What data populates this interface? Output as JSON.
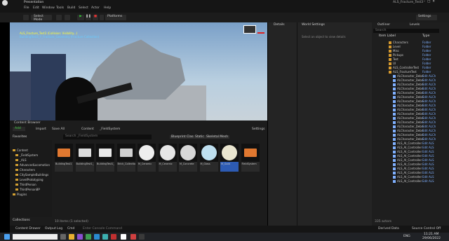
{
  "window": {
    "project_tab": "Presentation",
    "app_title": "ALS_Fracture_Test3"
  },
  "menu": [
    "File",
    "Edit",
    "Window",
    "Tools",
    "Build",
    "Select",
    "Actor",
    "Help"
  ],
  "toolbar": {
    "select_mode": "Select Mode",
    "platforms": "Platforms",
    "settings": "Settings"
  },
  "viewport": {
    "overlay1": "ALS_Fracture_Test3 (Collision: Visibility...)",
    "overlay2": "BuildingTest3_Y_Fracture_Geometry (Fracture Collection)"
  },
  "details": {
    "tab1": "Details",
    "tab2": "World Settings",
    "empty_msg": "Select an object to view details"
  },
  "outliner": {
    "tab1": "Outliner",
    "tab2": "Levels",
    "search": "Search",
    "col_label": "Item Label",
    "col_type": "Type",
    "actor_count": "335 actors",
    "rows": [
      {
        "label": "Characters",
        "type": "Folder"
      },
      {
        "label": "Level",
        "type": "Folder"
      },
      {
        "label": "Misc",
        "type": "Folder"
      },
      {
        "label": "Pickups",
        "type": "Folder"
      },
      {
        "label": "Test",
        "type": "Folder"
      },
      {
        "label": "UI",
        "type": "Folder"
      },
      {
        "label": "ALS_ControllerTest",
        "type": "Folder"
      },
      {
        "label": "ALS_FractureTest",
        "type": "Folder"
      },
      {
        "label": "ALCharacter_Debri",
        "type": "Edit ALCh"
      },
      {
        "label": "ALCharacter_Debri",
        "type": "Edit ALCh"
      },
      {
        "label": "ALCharacter_Debri",
        "type": "Edit ALCh"
      },
      {
        "label": "ALCharacter_Debri",
        "type": "Edit ALCh"
      },
      {
        "label": "ALCharacter_Debri",
        "type": "Edit ALCh"
      },
      {
        "label": "ALCharacter_Debri",
        "type": "Edit ALCh"
      },
      {
        "label": "ALCharacter_Debri",
        "type": "Edit ALCh"
      },
      {
        "label": "ALCharacter_Debri",
        "type": "Edit ALCh"
      },
      {
        "label": "ALCharacter_Debri",
        "type": "Edit ALCh"
      },
      {
        "label": "ALCharacter_Debri",
        "type": "Edit ALCh"
      },
      {
        "label": "ALCharacter_Debri",
        "type": "Edit ALCh"
      },
      {
        "label": "ALCharacter_Debri",
        "type": "Edit ALCh"
      },
      {
        "label": "ALCharacter_Debri",
        "type": "Edit ALCh"
      },
      {
        "label": "ALCharacter_Debri",
        "type": "Edit ALCh"
      },
      {
        "label": "ALCharacter_Debri",
        "type": "Edit ALCh"
      },
      {
        "label": "ALCharacter_Debri",
        "type": "Edit ALCh"
      },
      {
        "label": "ALS_AI_Controller",
        "type": "Edit ALS"
      },
      {
        "label": "ALS_AI_Controller",
        "type": "Edit ALS"
      },
      {
        "label": "ALS_AI_Controller",
        "type": "Edit ALS"
      },
      {
        "label": "ALS_AI_Controller",
        "type": "Edit ALS"
      },
      {
        "label": "ALS_AI_Controller",
        "type": "Edit ALS"
      },
      {
        "label": "ALS_AI_Controller",
        "type": "Edit ALS"
      },
      {
        "label": "ALS_AI_Controller",
        "type": "Edit ALS"
      },
      {
        "label": "ALS_AI_Controller",
        "type": "Edit ALS"
      },
      {
        "label": "ALS_AI_Controller",
        "type": "Edit ALS"
      },
      {
        "label": "ALS_AI_Controller",
        "type": "Edit ALS"
      }
    ]
  },
  "content_browser": {
    "tab": "Content Browser",
    "add": "Add",
    "import": "Import",
    "save_all": "Save All",
    "path1": "Content",
    "path2": "_FieldSystem",
    "search": "Search _FieldSystem",
    "settings": "Settings",
    "filters": [
      "Blueprint Class",
      "Static",
      "Skeletal Mesh"
    ],
    "favorites": "Favorites",
    "project": "ALS_Fracture_Test3",
    "collections": "Collections",
    "count": "10 items (1 selected)",
    "tree": [
      "Content",
      "_FieldSystem",
      "_ALS",
      "AdvancedLocomotion",
      "Characters",
      "CitySampleBuildings",
      "LevelPrototyping",
      "ThirdPerson",
      "ThirdPersonBP",
      "Plugins"
    ],
    "assets": [
      {
        "name": "BuildingTest1",
        "color": "#e07830"
      },
      {
        "name": "BuildingTest1_LOD1_GEO",
        "color": "#dcdcdc"
      },
      {
        "name": "BuildingTest1_LOD2_GEO",
        "color": "#e8e8e8"
      },
      {
        "name": "Brick_Collection",
        "color": "#d0d0d0"
      },
      {
        "name": "M_Ceramic",
        "color": "#eeeeee"
      },
      {
        "name": "M_Ceramic",
        "color": "#e6e6e6"
      },
      {
        "name": "M_Concrete",
        "color": "#d8d8d8"
      },
      {
        "name": "M_Glass",
        "color": "#bfe0f0"
      },
      {
        "name": "M_Gold",
        "color": "#e9e5cf"
      },
      {
        "name": "FieldSystem",
        "color": "#e07830"
      }
    ]
  },
  "statusbar": {
    "content_drawer": "Content Drawer",
    "output_log": "Output Log",
    "cmd": "Cmd",
    "console_placeholder": "Enter Console Command",
    "derived": "Derived Data",
    "source": "Source Control Off"
  },
  "taskbar": {
    "time": "11:21 AM",
    "date": "29/06/2022",
    "lang": "ENG"
  }
}
